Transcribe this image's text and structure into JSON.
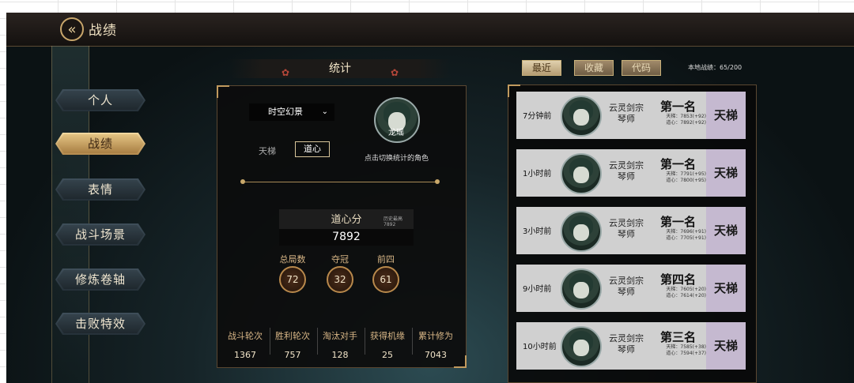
{
  "header": {
    "title": "战绩",
    "back_icon": "double-arrow-left-icon"
  },
  "menu": [
    {
      "label": "个人",
      "active": false
    },
    {
      "label": "战绩",
      "active": true
    },
    {
      "label": "表情",
      "active": false
    },
    {
      "label": "战斗场景",
      "active": false
    },
    {
      "label": "修炼卷轴",
      "active": false
    },
    {
      "label": "击败特效",
      "active": false
    }
  ],
  "stats": {
    "header": "统计",
    "mode_selected": "时空幻景",
    "character_name": "龙瑶",
    "switch_hint": "点击切换统计的角色",
    "tab_ladder": "天梯",
    "tab_daoxin": "道心",
    "score_label": "道心分",
    "score_best": "历史最高7892",
    "score_value": "7892",
    "circles": [
      {
        "label": "总局数",
        "value": "72"
      },
      {
        "label": "夺冠",
        "value": "32"
      },
      {
        "label": "前四",
        "value": "61"
      }
    ],
    "bottom": [
      {
        "label": "战斗轮次",
        "value": "1367"
      },
      {
        "label": "胜利轮次",
        "value": "757"
      },
      {
        "label": "淘汰对手",
        "value": "128"
      },
      {
        "label": "获得机缘",
        "value": "25"
      },
      {
        "label": "累计修为",
        "value": "7043"
      }
    ]
  },
  "history": {
    "tabs": [
      {
        "label": "最近",
        "active": true
      },
      {
        "label": "收藏",
        "active": false
      },
      {
        "label": "代码",
        "active": false
      }
    ],
    "local_count": "本地战绩：65/200",
    "records": [
      {
        "time": "7分钟前",
        "sect": "云灵剑宗",
        "role": "琴师",
        "rank": "第一名",
        "ladder": "天梯：7853(+92)",
        "daoxin": "道心：7892(+92)",
        "type": "天梯"
      },
      {
        "time": "1小时前",
        "sect": "云灵剑宗",
        "role": "琴师",
        "rank": "第一名",
        "ladder": "天梯：7791(+95)",
        "daoxin": "道心：7800(+95)",
        "type": "天梯"
      },
      {
        "time": "3小时前",
        "sect": "云灵剑宗",
        "role": "琴师",
        "rank": "第一名",
        "ladder": "天梯：7696(+91)",
        "daoxin": "道心：7705(+91)",
        "type": "天梯"
      },
      {
        "time": "9小时前",
        "sect": "云灵剑宗",
        "role": "琴师",
        "rank": "第四名",
        "ladder": "天梯：7605(+20)",
        "daoxin": "道心：7614(+20)",
        "type": "天梯"
      },
      {
        "time": "10小时前",
        "sect": "云灵剑宗",
        "role": "琴师",
        "rank": "第三名",
        "ladder": "天梯：7585(+38)",
        "daoxin": "道心：7594(+37)",
        "type": "天梯"
      }
    ]
  }
}
